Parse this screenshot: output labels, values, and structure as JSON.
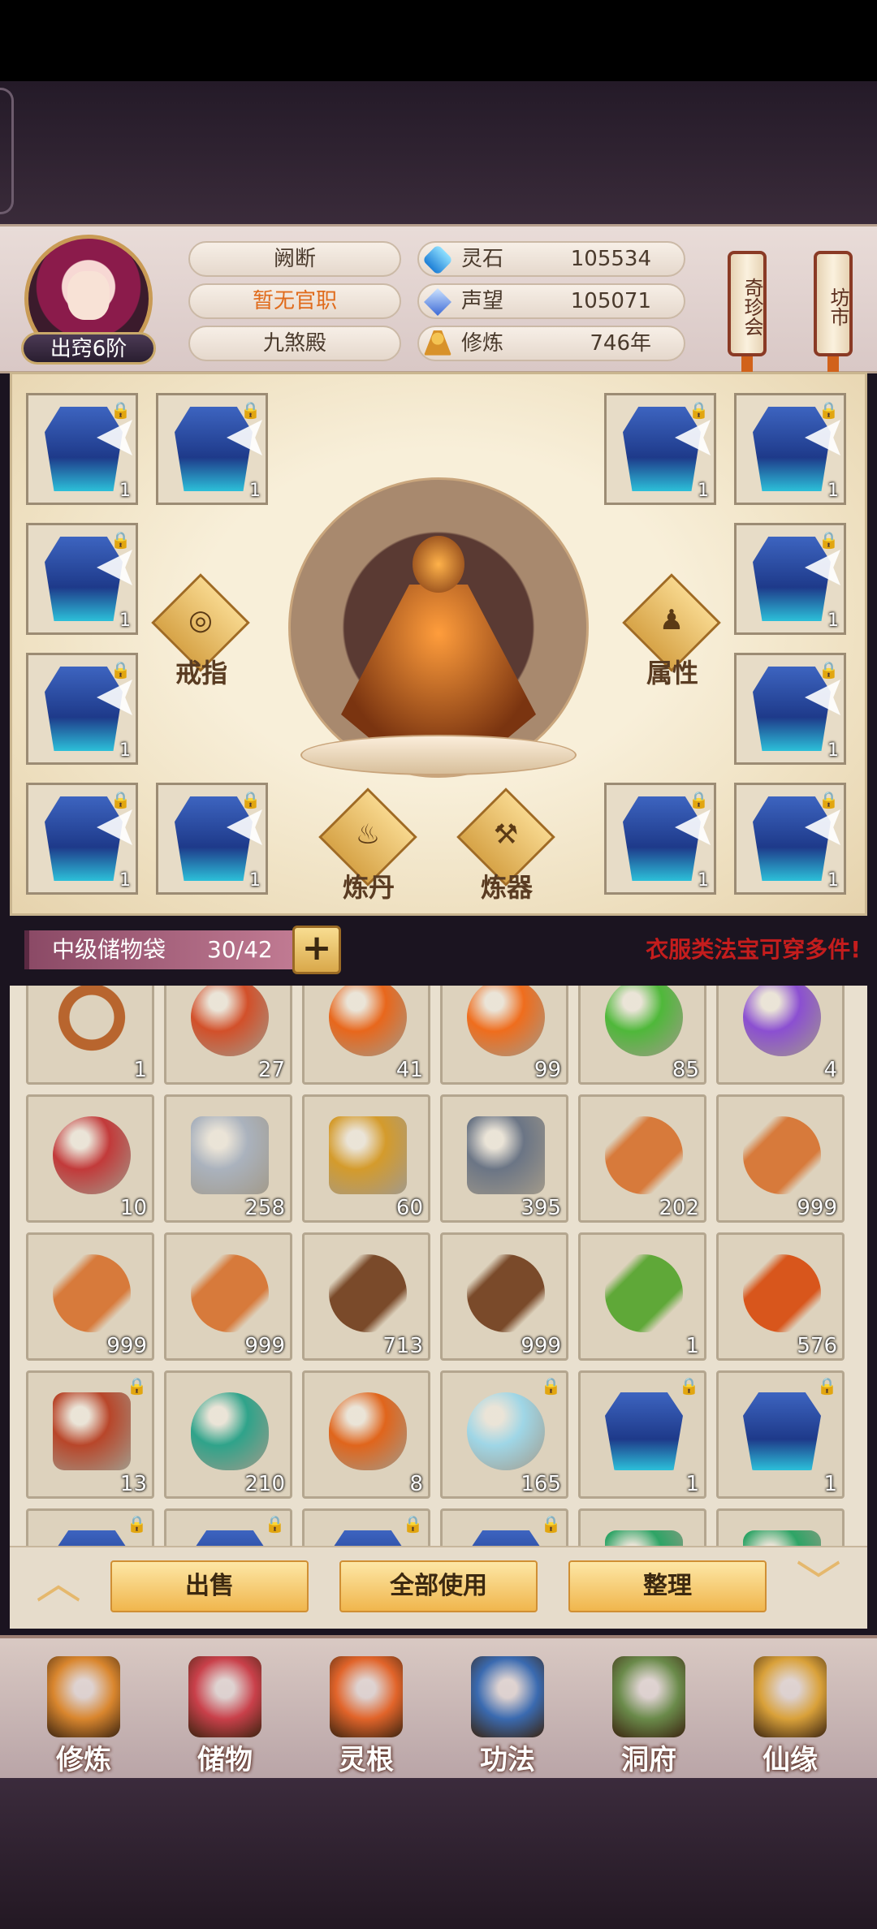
{
  "header": {
    "rank": "出窍6阶",
    "name": "阙断",
    "official": "暂无官职",
    "sect": "九煞殿",
    "stats": [
      {
        "label": "灵石",
        "value": "105534",
        "icon": "spirit-stone-icon",
        "color": "#3aa7f0"
      },
      {
        "label": "声望",
        "value": "105071",
        "icon": "prestige-crystal-icon",
        "color": "#5d8ee8"
      },
      {
        "label": "修炼",
        "value": "746年",
        "icon": "meditation-icon",
        "color": "#e2a13a"
      }
    ],
    "banners": [
      {
        "label": "奇珍会"
      },
      {
        "label": "坊市"
      }
    ]
  },
  "equipment": {
    "slots_count": [
      "1",
      "1",
      "1",
      "1",
      "1",
      "1",
      "1",
      "1",
      "1",
      "1",
      "1",
      "1"
    ],
    "ring_label": "戒指",
    "attr_label": "属性",
    "alchemy_label": "炼丹",
    "forge_label": "炼器"
  },
  "bag": {
    "title": "中级储物袋",
    "count": "30/42",
    "add_symbol": "+",
    "tip": "衣服类法宝可穿多件!"
  },
  "inventory": [
    {
      "count": "1",
      "color": "#b8652e",
      "shape": "ring"
    },
    {
      "count": "27",
      "color": "#d2502a",
      "shape": "orb"
    },
    {
      "count": "41",
      "color": "#e8671c",
      "shape": "orb"
    },
    {
      "count": "99",
      "color": "#ef6d1d",
      "shape": "orb"
    },
    {
      "count": "85",
      "color": "#4fb83a",
      "shape": "orb"
    },
    {
      "count": "4",
      "color": "#8b4fd1",
      "shape": "orb"
    },
    {
      "count": "10",
      "color": "#c23a3a",
      "shape": "orb"
    },
    {
      "count": "258",
      "color": "#aab2bd",
      "shape": "ore"
    },
    {
      "count": "60",
      "color": "#d49b2c",
      "shape": "ore"
    },
    {
      "count": "395",
      "color": "#6b7585",
      "shape": "ore"
    },
    {
      "count": "202",
      "color": "#d77a3b",
      "shape": "root"
    },
    {
      "count": "999",
      "color": "#d77a3b",
      "shape": "root"
    },
    {
      "count": "999",
      "color": "#d77a3b",
      "shape": "root"
    },
    {
      "count": "999",
      "color": "#d77a3b",
      "shape": "root"
    },
    {
      "count": "713",
      "color": "#7a4a2a",
      "shape": "root"
    },
    {
      "count": "999",
      "color": "#7a4a2a",
      "shape": "root"
    },
    {
      "count": "1",
      "color": "#5fa838",
      "shape": "herb"
    },
    {
      "count": "576",
      "color": "#d8561c",
      "shape": "herb"
    },
    {
      "count": "13",
      "color": "#b8462a",
      "shape": "crystal",
      "locked": true
    },
    {
      "count": "210",
      "color": "#2fa38a",
      "shape": "gourd"
    },
    {
      "count": "8",
      "color": "#e0651c",
      "shape": "gourd"
    },
    {
      "count": "165",
      "color": "#9fd6e6",
      "shape": "bottle",
      "locked": true
    },
    {
      "count": "1",
      "color": "#3d64c0",
      "shape": "armor",
      "locked": true
    },
    {
      "count": "1",
      "color": "#3d64c0",
      "shape": "armor",
      "locked": true
    },
    {
      "count": "",
      "color": "#3d64c0",
      "shape": "armor",
      "locked": true
    },
    {
      "count": "",
      "color": "#3d64c0",
      "shape": "armor",
      "locked": true
    },
    {
      "count": "",
      "color": "#3d64c0",
      "shape": "armor",
      "locked": true
    },
    {
      "count": "",
      "color": "#3d64c0",
      "shape": "armor",
      "locked": true
    },
    {
      "count": "",
      "color": "#2ea466",
      "shape": "jade"
    },
    {
      "count": "",
      "color": "#2ea466",
      "shape": "jade"
    }
  ],
  "actions": {
    "sell": "出售",
    "use_all": "全部使用",
    "sort": "整理",
    "up_arrow": "︿",
    "down_arrow": "﹀"
  },
  "nav": [
    {
      "label": "修炼",
      "icon": "cultivation-icon",
      "color": "#d9862e"
    },
    {
      "label": "储物",
      "icon": "storage-bag-icon",
      "color": "#c9404a"
    },
    {
      "label": "灵根",
      "icon": "spirit-root-icon",
      "color": "#e1642a"
    },
    {
      "label": "功法",
      "icon": "technique-book-icon",
      "color": "#3a6ab0"
    },
    {
      "label": "洞府",
      "icon": "cave-dwelling-icon",
      "color": "#6a8a4a"
    },
    {
      "label": "仙缘",
      "icon": "immortal-fate-icon",
      "color": "#d9a13a"
    }
  ]
}
